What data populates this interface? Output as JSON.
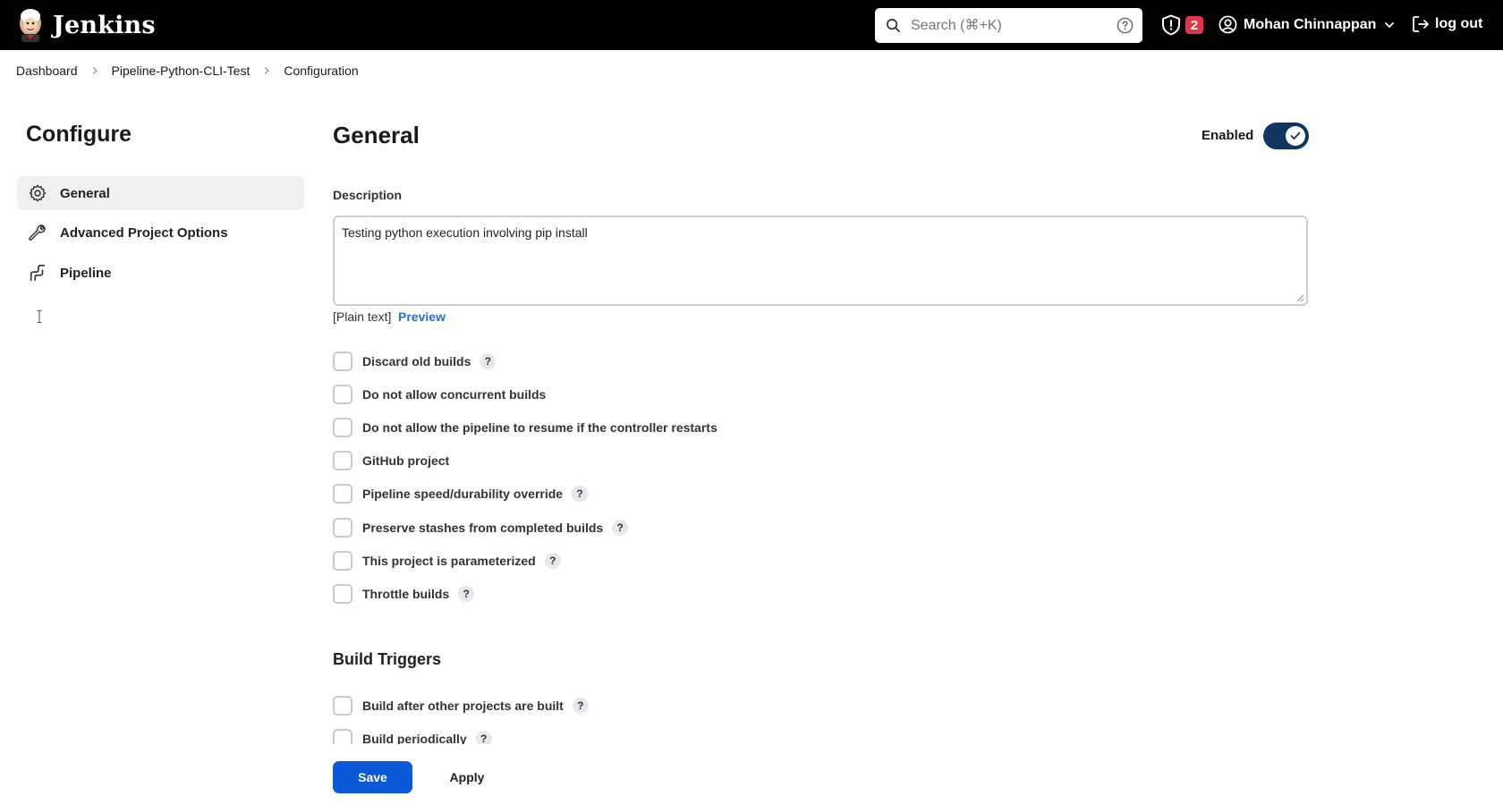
{
  "header": {
    "brand": "Jenkins",
    "search_placeholder": "Search (⌘+K)",
    "security_count": "2",
    "user_name": "Mohan Chinnappan",
    "logout_label": "log out"
  },
  "breadcrumbs": [
    "Dashboard",
    "Pipeline-Python-CLI-Test",
    "Configuration"
  ],
  "sidebar": {
    "title": "Configure",
    "items": [
      {
        "label": "General",
        "icon": "gear-icon",
        "active": true
      },
      {
        "label": "Advanced Project Options",
        "icon": "wrench-icon",
        "active": false
      },
      {
        "label": "Pipeline",
        "icon": "pipeline-icon",
        "active": false
      }
    ]
  },
  "general": {
    "title": "General",
    "enabled_label": "Enabled",
    "enabled": true,
    "description_label": "Description",
    "description_value": "Testing python execution involving pip install",
    "plain_text_label": "[Plain text]",
    "preview_label": "Preview",
    "options": [
      {
        "label": "Discard old builds",
        "help": true,
        "checked": false
      },
      {
        "label": "Do not allow concurrent builds",
        "help": false,
        "checked": false
      },
      {
        "label": "Do not allow the pipeline to resume if the controller restarts",
        "help": false,
        "checked": false
      },
      {
        "label": "GitHub project",
        "help": false,
        "checked": false
      },
      {
        "label": "Pipeline speed/durability override",
        "help": true,
        "checked": false
      },
      {
        "label": "Preserve stashes from completed builds",
        "help": true,
        "checked": false
      },
      {
        "label": "This project is parameterized",
        "help": true,
        "checked": false
      },
      {
        "label": "Throttle builds",
        "help": true,
        "checked": false
      }
    ]
  },
  "build_triggers": {
    "title": "Build Triggers",
    "options": [
      {
        "label": "Build after other projects are built",
        "help": true,
        "checked": false
      },
      {
        "label": "Build periodically",
        "help": true,
        "checked": false
      }
    ]
  },
  "footer": {
    "save_label": "Save",
    "apply_label": "Apply"
  },
  "help_glyph": "?",
  "colors": {
    "header_bg": "#000000",
    "badge": "#e6324b",
    "toggle_on": "#10365f",
    "link": "#2b6fd6",
    "primary_button": "#0b59d9"
  }
}
